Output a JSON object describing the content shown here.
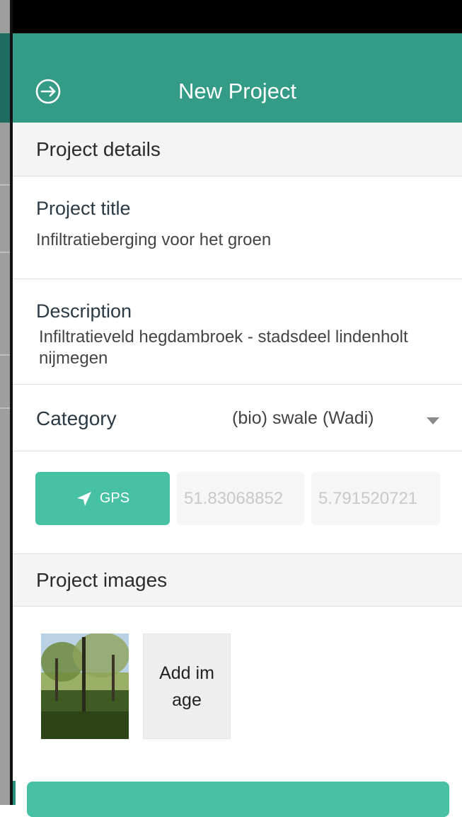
{
  "header": {
    "title": "New Project"
  },
  "sections": {
    "details_heading": "Project details",
    "images_heading": "Project images"
  },
  "fields": {
    "title_label": "Project title",
    "title_value": "Infiltratieberging voor het groen",
    "description_label": "Description",
    "description_value": "Infiltratieveld hegdambroek - stadsdeel lindenholt nijmegen",
    "category_label": "Category",
    "category_value": "(bio) swale (Wadi)"
  },
  "gps": {
    "button_label": "GPS",
    "latitude": "51.83068852",
    "longitude": "5.791520721"
  },
  "images": {
    "add_label": "Add image"
  },
  "colors": {
    "header_teal": "#349b86",
    "button_teal": "#46c1a3"
  }
}
